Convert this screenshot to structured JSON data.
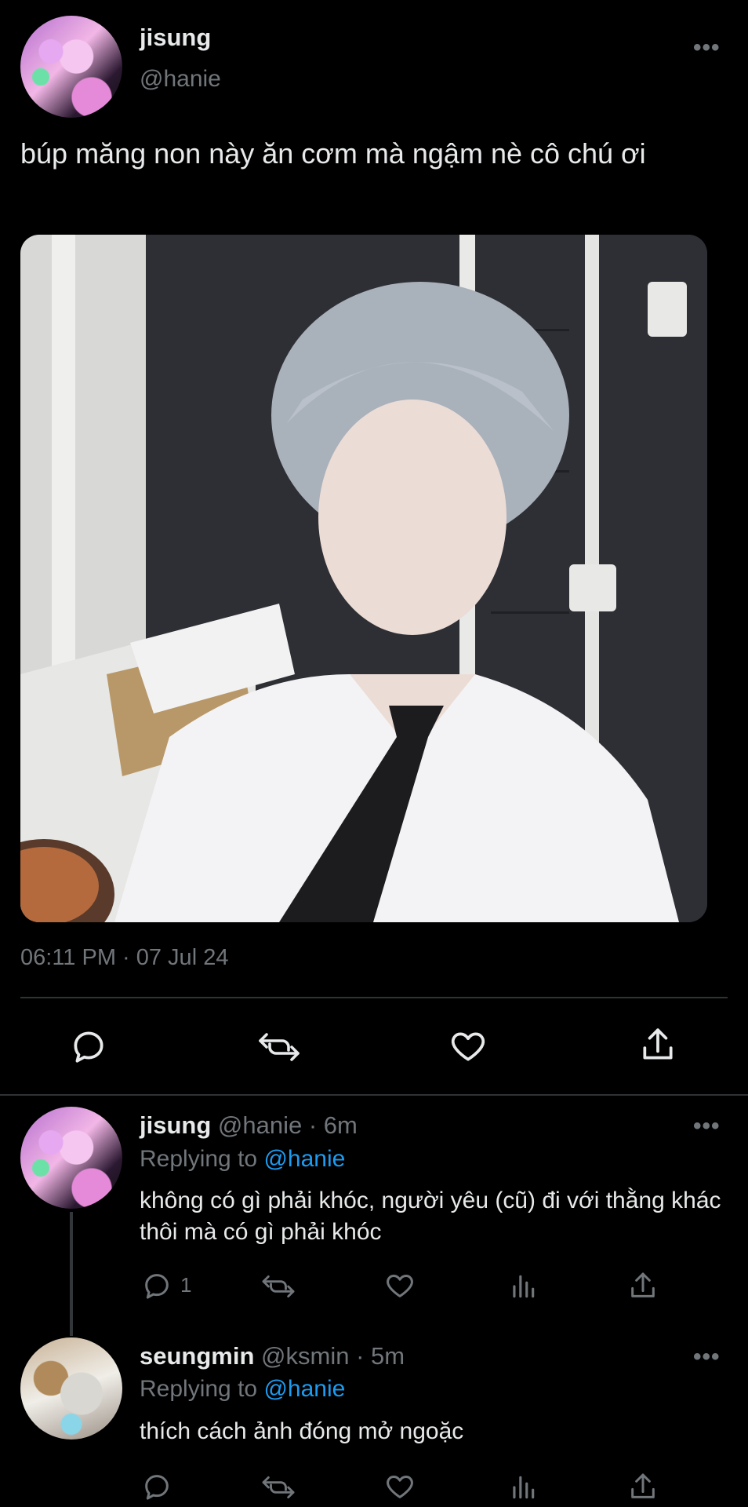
{
  "main_tweet": {
    "display_name": "jisung",
    "handle": "@hanie",
    "more_label": "•••",
    "text": "búp măng non này ăn cơm mà ngậm nè cô chú ơi",
    "timestamp": "06:11 PM · 07 Jul 24",
    "actions": [
      "reply-icon",
      "retweet-icon",
      "like-icon",
      "share-icon"
    ]
  },
  "replies": [
    {
      "display_name": "jisung",
      "meta": "@hanie · 6m",
      "replying_prefix": "Replying to",
      "replying_to": "@hanie",
      "text": "không có gì phải khóc, người yêu (cũ) đi với thằng khác thôi mà có gì phải khóc",
      "reply_count": "1",
      "more_label": "•••"
    },
    {
      "display_name": "seungmin",
      "meta": "@ksmin · 5m",
      "replying_prefix": "Replying to",
      "replying_to": "@hanie",
      "text": "thích cách ảnh đóng mở ngoặc",
      "reply_count": "",
      "more_label": "•••"
    }
  ],
  "colors": {
    "background": "#000000",
    "text": "#e7e9ea",
    "muted": "#71767b",
    "link": "#1d9bf0",
    "divider": "#2f3336"
  }
}
